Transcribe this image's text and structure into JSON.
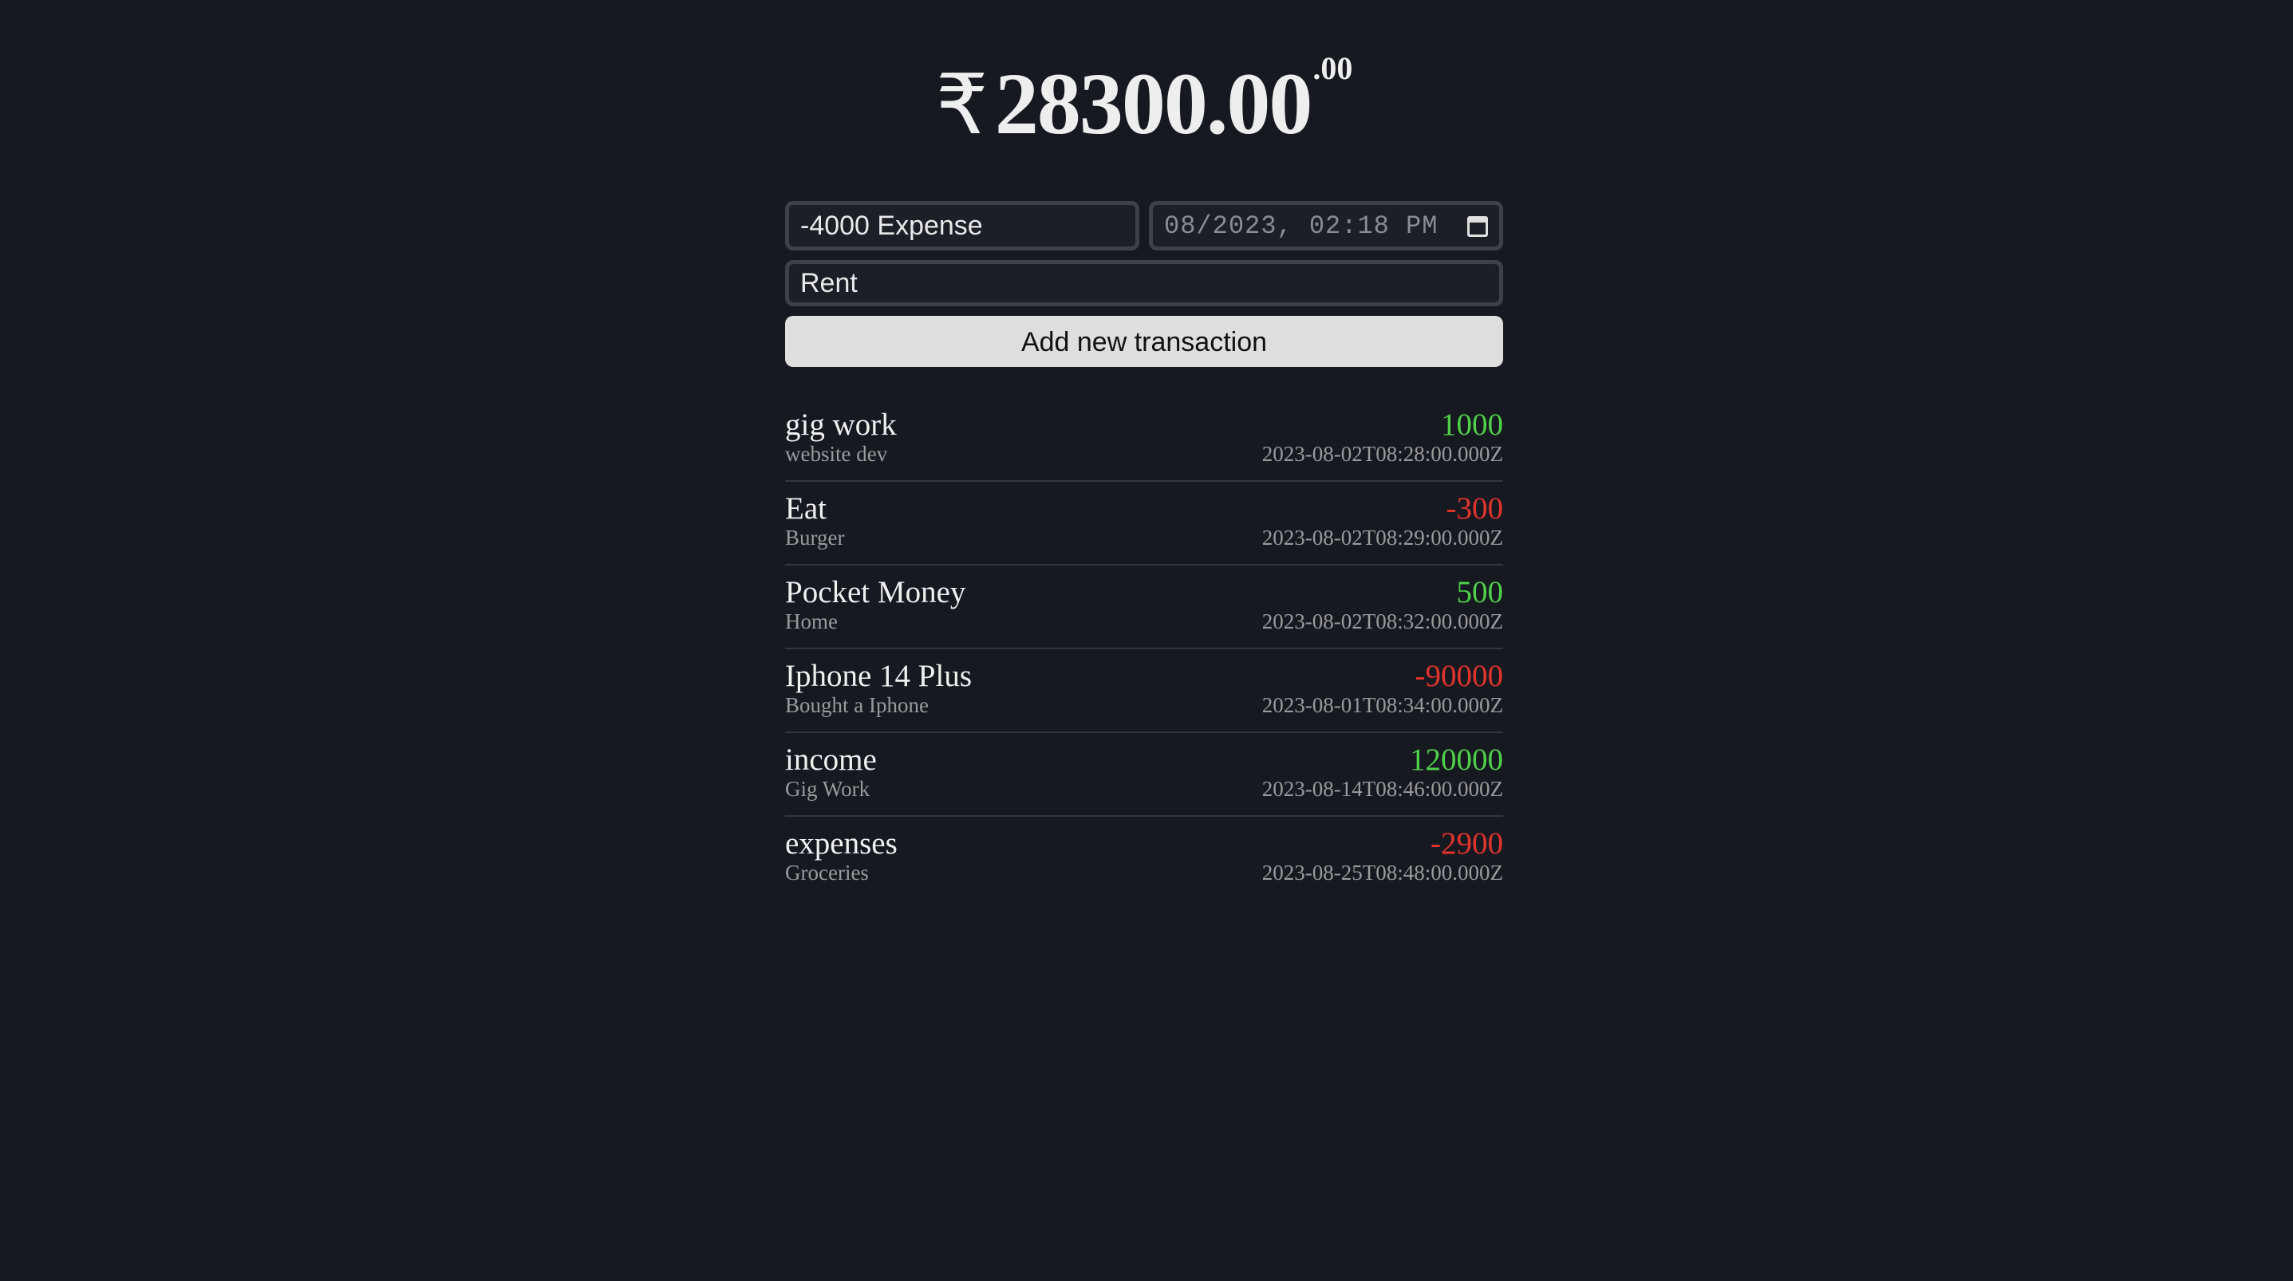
{
  "balance": {
    "currency_symbol": "₹",
    "amount": "28300.00",
    "cents": ".00"
  },
  "form": {
    "amount_value": "-4000 Expense",
    "datetime_value": "08/2023, 02:18 PM",
    "description_value": "Rent",
    "submit_label": "Add new transaction"
  },
  "colors": {
    "background": "#171920",
    "positive": "#4fd04a",
    "negative": "#e0342e"
  },
  "transactions": [
    {
      "name": "gig work",
      "description": "website dev",
      "price": "1000",
      "datetime": "2023-08-02T08:28:00.000Z",
      "sign": "pos"
    },
    {
      "name": "Eat",
      "description": "Burger",
      "price": "-300",
      "datetime": "2023-08-02T08:29:00.000Z",
      "sign": "neg"
    },
    {
      "name": "Pocket Money",
      "description": "Home",
      "price": "500",
      "datetime": "2023-08-02T08:32:00.000Z",
      "sign": "pos"
    },
    {
      "name": "Iphone 14 Plus",
      "description": "Bought a Iphone",
      "price": "-90000",
      "datetime": "2023-08-01T08:34:00.000Z",
      "sign": "neg"
    },
    {
      "name": "income",
      "description": "Gig Work",
      "price": "120000",
      "datetime": "2023-08-14T08:46:00.000Z",
      "sign": "pos"
    },
    {
      "name": "expenses",
      "description": "Groceries",
      "price": "-2900",
      "datetime": "2023-08-25T08:48:00.000Z",
      "sign": "neg"
    }
  ]
}
